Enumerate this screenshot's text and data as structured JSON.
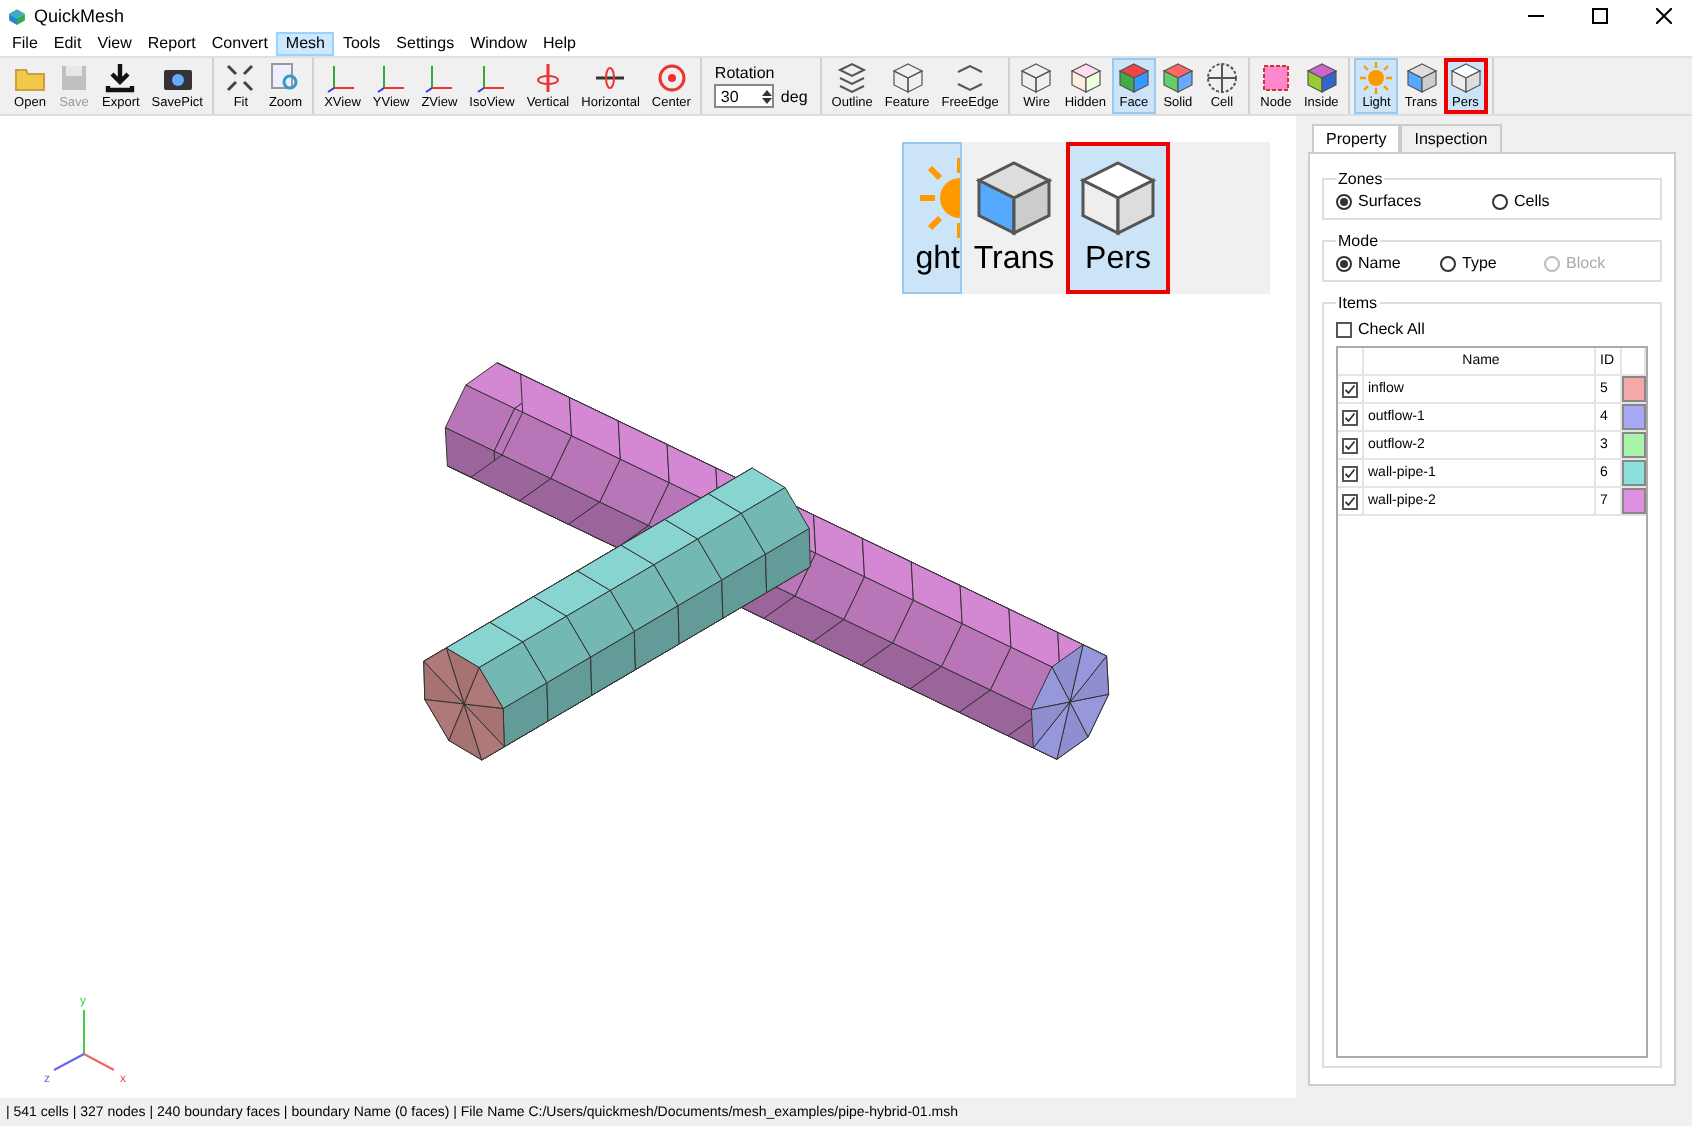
{
  "window": {
    "title": "QuickMesh"
  },
  "menu": [
    {
      "label": "File",
      "selected": false
    },
    {
      "label": "Edit",
      "selected": false
    },
    {
      "label": "View",
      "selected": false
    },
    {
      "label": "Report",
      "selected": false
    },
    {
      "label": "Convert",
      "selected": false
    },
    {
      "label": "Mesh",
      "selected": true
    },
    {
      "label": "Tools",
      "selected": false
    },
    {
      "label": "Settings",
      "selected": false
    },
    {
      "label": "Window",
      "selected": false
    },
    {
      "label": "Help",
      "selected": false
    }
  ],
  "toolbar": {
    "groups": [
      [
        {
          "label": "Open",
          "selected": false,
          "disabled": false,
          "highlighted": false
        },
        {
          "label": "Save",
          "selected": false,
          "disabled": true,
          "highlighted": false
        },
        {
          "label": "Export",
          "selected": false,
          "disabled": false,
          "highlighted": false
        },
        {
          "label": "SavePict",
          "selected": false,
          "disabled": false,
          "highlighted": false
        }
      ],
      [
        {
          "label": "Fit",
          "selected": false,
          "disabled": false,
          "highlighted": false
        },
        {
          "label": "Zoom",
          "selected": false,
          "disabled": false,
          "highlighted": false
        }
      ],
      [
        {
          "label": "XView",
          "selected": false,
          "disabled": false,
          "highlighted": false
        },
        {
          "label": "YView",
          "selected": false,
          "disabled": false,
          "highlighted": false
        },
        {
          "label": "ZView",
          "selected": false,
          "disabled": false,
          "highlighted": false
        },
        {
          "label": "IsoView",
          "selected": false,
          "disabled": false,
          "highlighted": false
        },
        {
          "label": "Vertical",
          "selected": false,
          "disabled": false,
          "highlighted": false
        },
        {
          "label": "Horizontal",
          "selected": false,
          "disabled": false,
          "highlighted": false
        },
        {
          "label": "Center",
          "selected": false,
          "disabled": false,
          "highlighted": false
        }
      ],
      [
        {
          "label": "Outline",
          "selected": false,
          "disabled": false,
          "highlighted": false
        },
        {
          "label": "Feature",
          "selected": false,
          "disabled": false,
          "highlighted": false
        },
        {
          "label": "FreeEdge",
          "selected": false,
          "disabled": false,
          "highlighted": false
        }
      ],
      [
        {
          "label": "Wire",
          "selected": false,
          "disabled": false,
          "highlighted": false
        },
        {
          "label": "Hidden",
          "selected": false,
          "disabled": false,
          "highlighted": false
        },
        {
          "label": "Face",
          "selected": true,
          "disabled": false,
          "highlighted": false
        },
        {
          "label": "Solid",
          "selected": false,
          "disabled": false,
          "highlighted": false
        },
        {
          "label": "Cell",
          "selected": false,
          "disabled": false,
          "highlighted": false
        }
      ],
      [
        {
          "label": "Node",
          "selected": false,
          "disabled": false,
          "highlighted": false
        },
        {
          "label": "Inside",
          "selected": false,
          "disabled": false,
          "highlighted": false
        }
      ],
      [
        {
          "label": "Light",
          "selected": true,
          "disabled": false,
          "highlighted": false
        },
        {
          "label": "Trans",
          "selected": false,
          "disabled": false,
          "highlighted": false
        },
        {
          "label": "Pers",
          "selected": true,
          "disabled": false,
          "highlighted": true
        }
      ]
    ],
    "rotation": {
      "label": "Rotation",
      "value": "30",
      "unit": "deg"
    }
  },
  "viewport": {
    "inset": [
      {
        "label": "ght",
        "selected": true,
        "highlighted": false
      },
      {
        "label": "Trans",
        "selected": false,
        "highlighted": false
      },
      {
        "label": "Pers",
        "selected": true,
        "highlighted": true
      }
    ],
    "axes": [
      {
        "label": "y"
      },
      {
        "label": "z"
      },
      {
        "label": "x"
      }
    ]
  },
  "panel": {
    "tabs": [
      {
        "label": "Property",
        "selected": true
      },
      {
        "label": "Inspection",
        "selected": false
      }
    ],
    "zones": {
      "title": "Zones",
      "options": [
        {
          "label": "Surfaces",
          "selected": true,
          "disabled": false
        },
        {
          "label": "Cells",
          "selected": false,
          "disabled": false
        }
      ]
    },
    "mode": {
      "title": "Mode",
      "options": [
        {
          "label": "Name",
          "selected": true,
          "disabled": false
        },
        {
          "label": "Type",
          "selected": false,
          "disabled": false
        },
        {
          "label": "Block",
          "selected": false,
          "disabled": true
        }
      ]
    },
    "items": {
      "title": "Items",
      "check_all": {
        "label": "Check All",
        "checked": false
      },
      "columns": [
        "Name",
        "ID"
      ],
      "rows": [
        {
          "name": "inflow",
          "id": "5",
          "checked": true,
          "color": "#f4a8a8"
        },
        {
          "name": "outflow-1",
          "id": "4",
          "checked": true,
          "color": "#a8a8f4"
        },
        {
          "name": "outflow-2",
          "id": "3",
          "checked": true,
          "color": "#a8f4a8"
        },
        {
          "name": "wall-pipe-1",
          "id": "6",
          "checked": true,
          "color": "#8ee0dc"
        },
        {
          "name": "wall-pipe-2",
          "id": "7",
          "checked": true,
          "color": "#e090e0"
        }
      ]
    }
  },
  "status_bar": "| 541 cells | 327 nodes | 240 boundary faces |  boundary Name  (0 faces) | File Name C:/Users/quickmesh/Documents/mesh_examples/pipe-hybrid-01.msh"
}
